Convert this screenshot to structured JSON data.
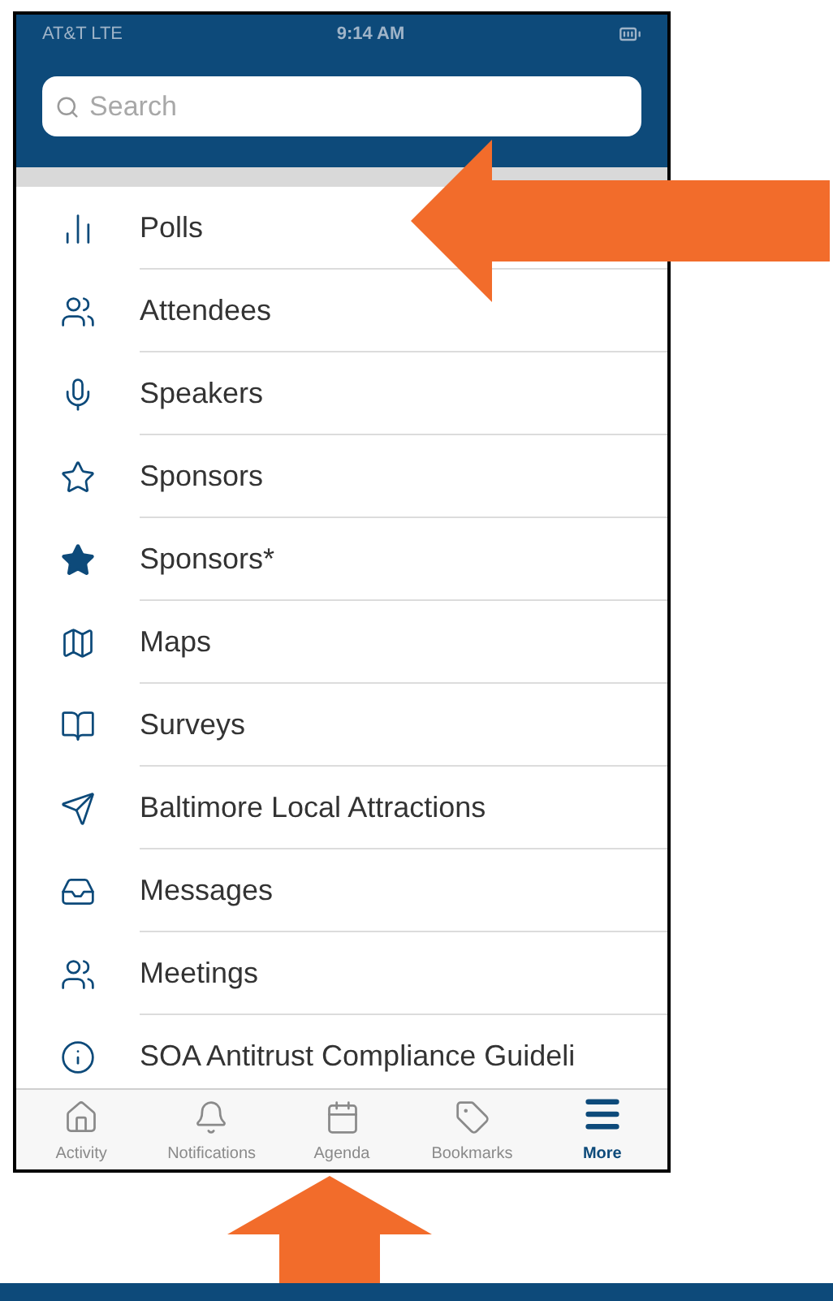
{
  "status_bar": {
    "carrier": "AT&T  LTE",
    "time": "9:14 AM"
  },
  "search": {
    "placeholder": "Search"
  },
  "menu": [
    {
      "label": "Polls"
    },
    {
      "label": "Attendees"
    },
    {
      "label": "Speakers"
    },
    {
      "label": "Sponsors"
    },
    {
      "label": "Sponsors*"
    },
    {
      "label": "Maps"
    },
    {
      "label": "Surveys"
    },
    {
      "label": "Baltimore Local Attractions"
    },
    {
      "label": "Messages"
    },
    {
      "label": "Meetings"
    },
    {
      "label": "SOA Antitrust Compliance Guideli"
    }
  ],
  "tabs": [
    {
      "label": "Activity",
      "selected": false
    },
    {
      "label": "Notifications",
      "selected": false
    },
    {
      "label": "Agenda",
      "selected": false
    },
    {
      "label": "Bookmarks",
      "selected": false
    },
    {
      "label": "More",
      "selected": true
    }
  ]
}
